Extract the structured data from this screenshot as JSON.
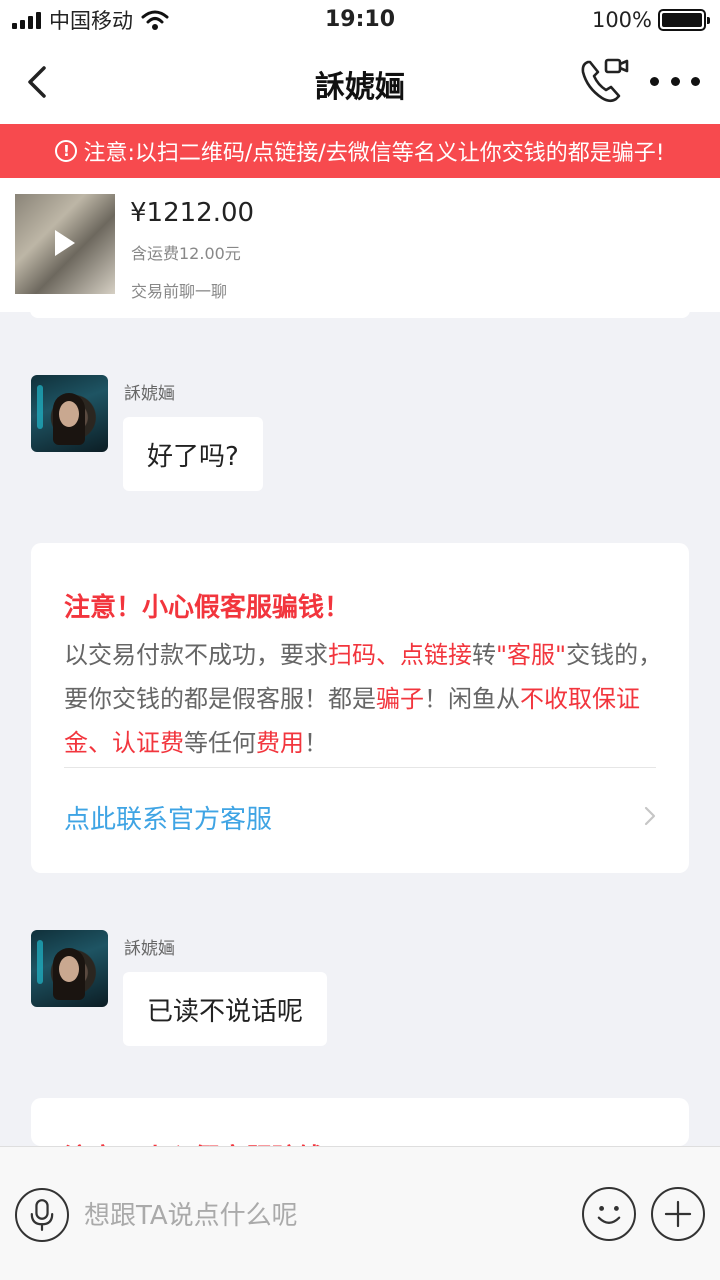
{
  "status_bar": {
    "carrier": "中国移动",
    "time": "19:10",
    "battery": "100%",
    "battery_level": 1.0
  },
  "nav": {
    "title": "訸婋婳",
    "back_icon": "chevron-left-icon",
    "call_icon": "phone-video-icon",
    "more_icon": "more-dots-icon"
  },
  "warning": {
    "icon": "exclamation-circle-icon",
    "text": "注意:以扫二维码/点链接/去微信等名义让你交钱的都是骗子!"
  },
  "product": {
    "price": "¥1212.00",
    "shipping": "含运费12.00元",
    "prechat": "交易前聊一聊",
    "play_icon": "play-icon"
  },
  "messages": [
    {
      "sender": "訸婋婳",
      "text": "好了吗?"
    },
    {
      "sender": "訸婋婳",
      "text": "已读不说话呢"
    }
  ],
  "notice": {
    "title": "注意！小心假客服骗钱！",
    "body_segments": [
      {
        "text": "以交易付款不成功，要求",
        "highlight": false
      },
      {
        "text": "扫码、点链接",
        "highlight": true
      },
      {
        "text": "转",
        "highlight": false
      },
      {
        "text": "\"客服\"",
        "highlight": true
      },
      {
        "text": "交钱的，要你交钱的都是假客服！都是",
        "highlight": false
      },
      {
        "text": "骗子",
        "highlight": true
      },
      {
        "text": "！闲鱼从",
        "highlight": false
      },
      {
        "text": "不收取保证金、认证费",
        "highlight": true
      },
      {
        "text": "等任何",
        "highlight": false
      },
      {
        "text": "费用",
        "highlight": true
      },
      {
        "text": "！",
        "highlight": false
      }
    ],
    "link": "点此联系官方客服",
    "second_title_partial": "注意！小心假客服骗钱！"
  },
  "input": {
    "placeholder": "想跟TA说点什么呢"
  },
  "colors": {
    "warning_bg": "#f74a4e",
    "notice_red": "#f2353d",
    "link_blue": "#3fa4e4",
    "chat_bg": "#f1f2f6"
  }
}
